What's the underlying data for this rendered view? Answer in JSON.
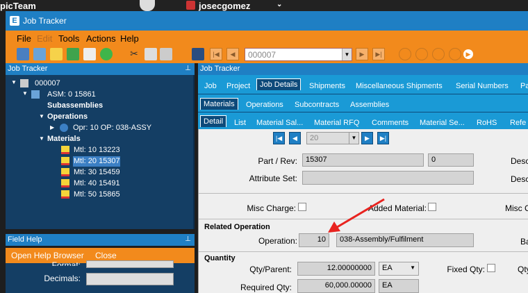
{
  "os": {
    "team": "picTeam",
    "user": "josecgomez"
  },
  "window": {
    "title": "Job Tracker",
    "logo": "E"
  },
  "menu": [
    "File",
    "Edit",
    "Tools",
    "Actions",
    "Help"
  ],
  "toolbar": {
    "record": "000007"
  },
  "left_panel": {
    "title": "Job Tracker"
  },
  "tree": {
    "root": "000007",
    "asm": "ASM: 0 15861",
    "subassemblies": "Subassemblies",
    "operations": "Operations",
    "opr": "Opr: 10 OP: 038-ASSY",
    "materials": "Materials",
    "mtl": [
      "Mtl: 10 13223",
      "Mtl: 20 15307",
      "Mtl: 30 15459",
      "Mtl: 40 15491",
      "Mtl: 50 15865"
    ]
  },
  "field_help": {
    "title": "Field Help",
    "open_browser": "Open Help Browser",
    "close": "Close",
    "format_label": "Format:",
    "decimals_label": "Decimals:"
  },
  "right_panel": {
    "title": "Job Tracker"
  },
  "tabs1": [
    "Job",
    "Project",
    "Job Details",
    "Shipments",
    "Miscellaneous Shipments",
    "Serial Numbers",
    "Pa"
  ],
  "tabs2": [
    "Materials",
    "Operations",
    "Subcontracts",
    "Assemblies"
  ],
  "tabs3": [
    "Detail",
    "List",
    "Material Sal...",
    "Material RFQ",
    "Comments",
    "Material Se...",
    "RoHS",
    "Refe"
  ],
  "pager": {
    "value": "20"
  },
  "form": {
    "part_rev_label": "Part / Rev:",
    "part": "15307",
    "rev": "0",
    "desc1": "Desc",
    "attribute_set_label": "Attribute Set:",
    "desc2": "Desc",
    "misc_charge_label": "Misc Charge:",
    "added_material_label": "Added Material:",
    "misc_c_label": "Misc C",
    "related_op_section": "Related Operation",
    "operation_label": "Operation:",
    "operation_num": "10",
    "operation_desc": "038-Assembly/Fulfilment",
    "ba_label": "Ba",
    "quantity_section": "Quantity",
    "qty_parent_label": "Qty/Parent:",
    "qty_parent": "12.00000000",
    "uom1": "EA",
    "fixed_qty_label": "Fixed Qty:",
    "qty_cut_label": "Qty",
    "required_qty_label": "Required Qty:",
    "required_qty": "60,000.00000",
    "uom2": "EA"
  },
  "colors": {
    "accent_orange": "#f28a1c",
    "title_blue": "#1f7fc4",
    "tree_bg": "#143e64",
    "tab_blue": "#1a9ad6",
    "arrow_red": "#e8231f"
  }
}
